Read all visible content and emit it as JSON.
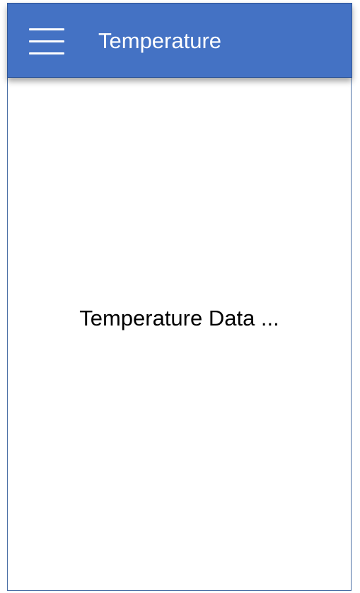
{
  "app_bar": {
    "title": "Temperature",
    "menu_icon": "hamburger-menu-icon",
    "background_color": "#4472c4",
    "text_color": "#ffffff"
  },
  "main": {
    "placeholder_text": "Temperature Data ..."
  }
}
